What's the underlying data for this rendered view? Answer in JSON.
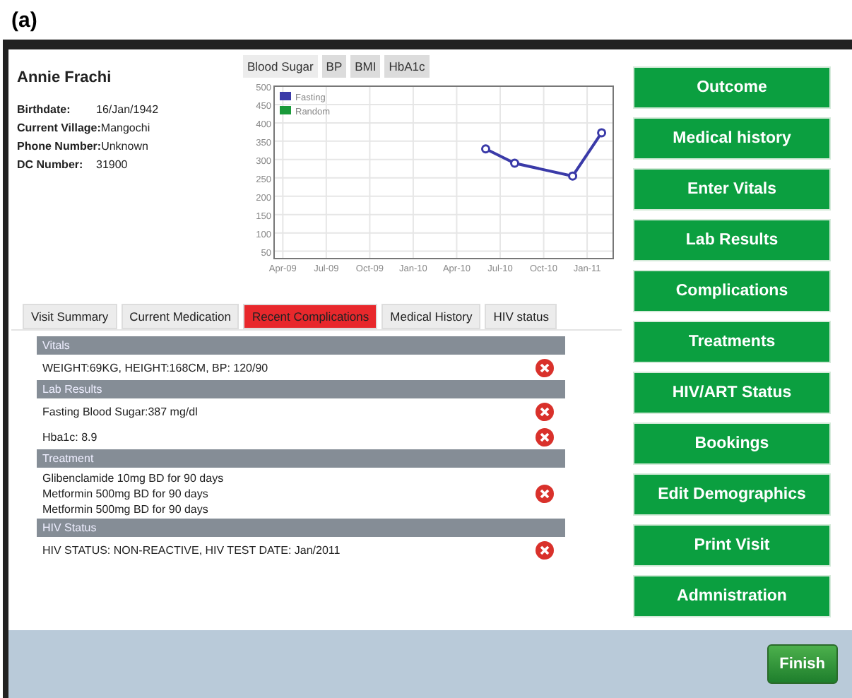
{
  "caption": "(a)",
  "patient": {
    "name": "Annie Frachi",
    "fields": [
      {
        "label": "Birthdate:",
        "value": "16/Jan/1942"
      },
      {
        "label": "Current Village:",
        "value": "Mangochi"
      },
      {
        "label": "Phone Number:",
        "value": "Unknown"
      },
      {
        "label": "DC Number:",
        "value": "31900"
      }
    ]
  },
  "chart_tabs": [
    {
      "label": "Blood Sugar",
      "selected": true
    },
    {
      "label": "BP",
      "selected": false
    },
    {
      "label": "BMI",
      "selected": false
    },
    {
      "label": "HbA1c",
      "selected": false
    }
  ],
  "chart_data": {
    "type": "line",
    "categories": [
      "Apr-09",
      null,
      null,
      "Jul-09",
      null,
      null,
      "Oct-09",
      null,
      null,
      "Jan-10",
      null,
      null,
      "Apr-10",
      null,
      null,
      "Jul-10",
      null,
      null,
      "Oct-10",
      null,
      null,
      "Jan-11",
      null
    ],
    "series": [
      {
        "name": "Fasting",
        "color": "#3a3aa8",
        "marker": "circle",
        "values": [
          null,
          null,
          null,
          null,
          null,
          null,
          null,
          null,
          null,
          null,
          null,
          null,
          null,
          null,
          329,
          null,
          290,
          null,
          null,
          null,
          255,
          null,
          373
        ]
      },
      {
        "name": "Random",
        "color": "#1a9a3a",
        "values": [
          null,
          null,
          null,
          null,
          null,
          null,
          null,
          null,
          null,
          null,
          null,
          null,
          null,
          null,
          null,
          null,
          null,
          null,
          null,
          null,
          null,
          null,
          null
        ]
      }
    ],
    "ylim": [
      30,
      500
    ],
    "grid": true,
    "yticks": [
      50,
      100,
      150,
      200,
      250,
      300,
      350,
      400,
      450,
      500
    ]
  },
  "tabs": [
    {
      "label": "Visit Summary",
      "selected": false,
      "kind": "plain"
    },
    {
      "label": "Current Medication",
      "selected": false,
      "kind": "plain"
    },
    {
      "label": "Recent Complications",
      "selected": true,
      "kind": "alert"
    },
    {
      "label": "Medical History",
      "selected": false,
      "kind": "plain"
    },
    {
      "label": "HIV status",
      "selected": false,
      "kind": "plain"
    }
  ],
  "sections": [
    {
      "title": "Vitals",
      "items": [
        {
          "lines": [
            "WEIGHT:69KG, HEIGHT:168CM, BP: 120/90"
          ]
        }
      ]
    },
    {
      "title": "Lab Results",
      "items": [
        {
          "lines": [
            "Fasting Blood Sugar:387 mg/dl"
          ]
        },
        {
          "lines": [
            "Hba1c: 8.9"
          ]
        }
      ]
    },
    {
      "title": "Treatment",
      "items": [
        {
          "lines": [
            "Glibenclamide 10mg BD for 90 days",
            "Metformin 500mg BD for 90 days",
            "Metformin 500mg BD for 90 days"
          ]
        }
      ]
    },
    {
      "title": "HIV Status",
      "items": [
        {
          "lines": [
            "HIV STATUS: NON-REACTIVE, HIV TEST DATE: Jan/2011"
          ]
        }
      ]
    }
  ],
  "actions": [
    "Outcome",
    "Medical history",
    "Enter Vitals",
    "Lab Results",
    "Complications",
    "Treatments",
    "HIV/ART Status",
    "Bookings",
    "Edit Demographics",
    "Print Visit",
    "Admnistration"
  ],
  "finish": "Finish"
}
